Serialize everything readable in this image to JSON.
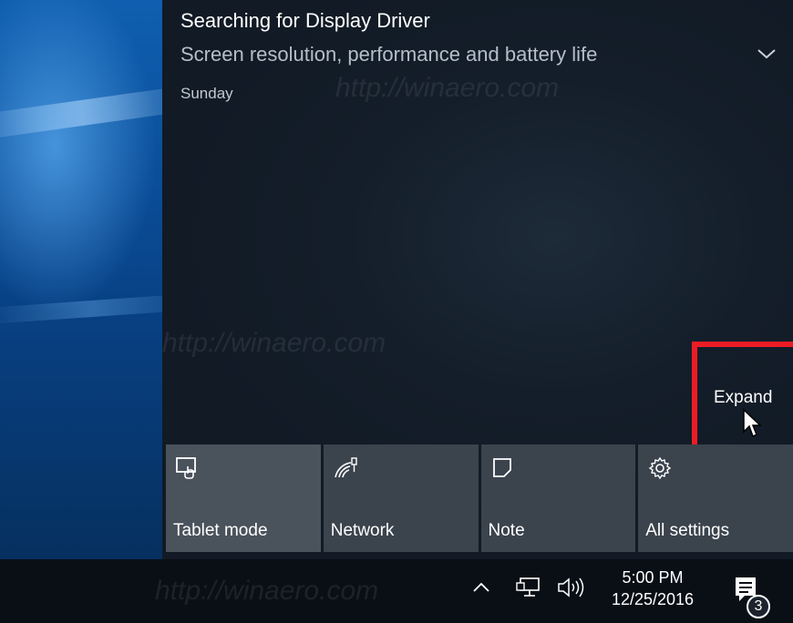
{
  "notification": {
    "title": "Searching for Display Driver",
    "body": "Screen resolution, performance and battery life",
    "time": "Sunday",
    "chevron_icon": "chevron-down-icon"
  },
  "action_center": {
    "expand_label": "Expand",
    "highlight_color": "#ed1c24"
  },
  "quick_actions": [
    {
      "label": "Tablet mode",
      "icon": "tablet-mode-icon"
    },
    {
      "label": "Network",
      "icon": "network-wifi-icon"
    },
    {
      "label": "Note",
      "icon": "note-icon"
    },
    {
      "label": "All settings",
      "icon": "gear-icon"
    }
  ],
  "taskbar": {
    "time": "5:00 PM",
    "date": "12/25/2016",
    "notification_count": "3"
  },
  "watermark": {
    "text": "http://winaero.com"
  }
}
